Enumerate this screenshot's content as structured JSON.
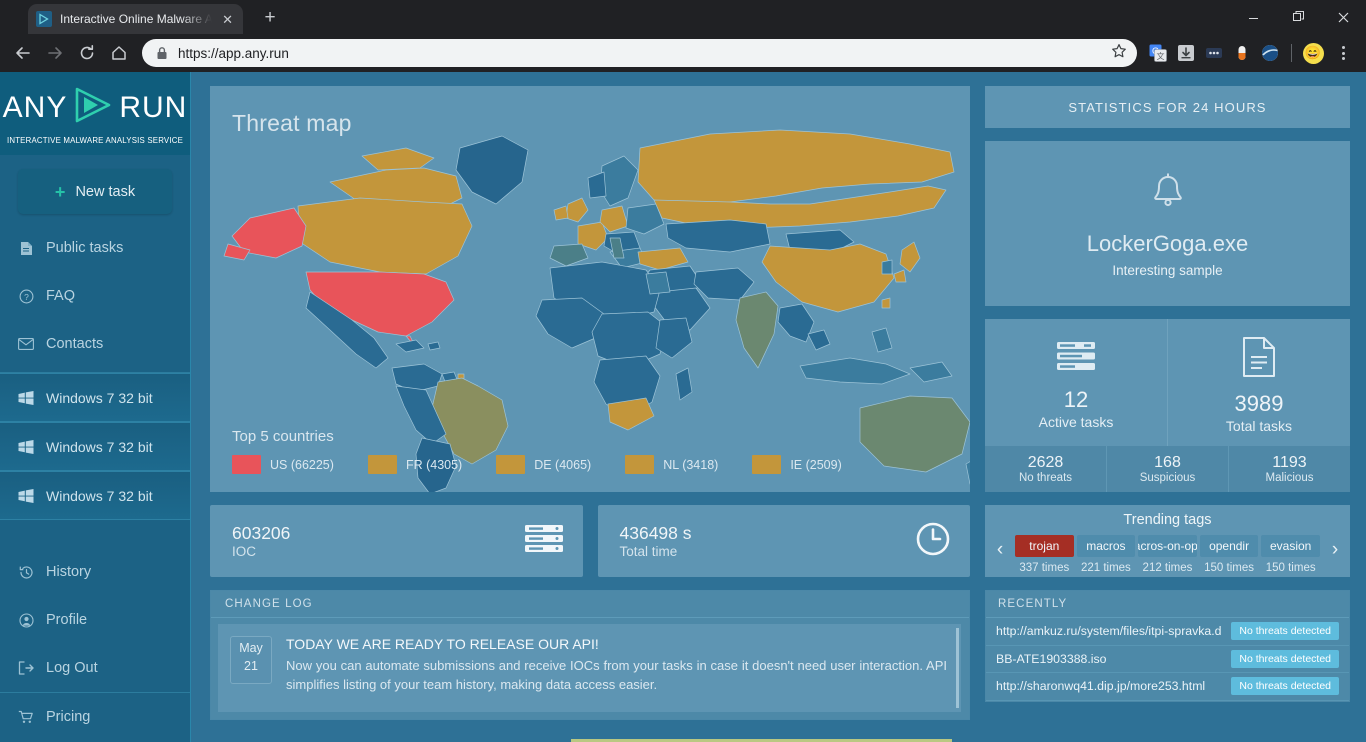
{
  "browser": {
    "tab_title": "Interactive Online Malware Ana",
    "tab_close": "✕",
    "new_tab": "+",
    "url": "https://app.any.run",
    "back_icon": "back-arrow",
    "forward_icon": "forward-arrow",
    "reload_icon": "reload",
    "home_icon": "home",
    "minimize": "–",
    "maximize": "❐",
    "close": "✕"
  },
  "sidebar": {
    "logo_any": "ANY",
    "logo_run": "RUN",
    "tagline": "INTERACTIVE MALWARE ANALYSIS SERVICE",
    "new_task": "New task",
    "nav": [
      {
        "label": "Public tasks",
        "icon": "document-icon"
      },
      {
        "label": "FAQ",
        "icon": "question-circle-icon"
      },
      {
        "label": "Contacts",
        "icon": "envelope-icon"
      }
    ],
    "vms": [
      {
        "label": "Windows 7 32 bit",
        "icon": "windows-icon"
      },
      {
        "label": "Windows 7 32 bit",
        "icon": "windows-icon"
      },
      {
        "label": "Windows 7 32 bit",
        "icon": "windows-icon"
      }
    ],
    "account": [
      {
        "label": "History",
        "icon": "history-icon"
      },
      {
        "label": "Profile",
        "icon": "user-circle-icon"
      },
      {
        "label": "Log Out",
        "icon": "logout-icon"
      }
    ],
    "footer": [
      {
        "label": "Pricing",
        "icon": "cart-icon"
      }
    ]
  },
  "threat_map": {
    "title": "Threat map",
    "legend_title": "Top 5 countries",
    "legend": [
      {
        "label": "US (66225)",
        "color": "#e8545a"
      },
      {
        "label": "FR (4305)",
        "color": "#c3963b"
      },
      {
        "label": "DE (4065)",
        "color": "#c3963b"
      },
      {
        "label": "NL (3418)",
        "color": "#c3963b"
      },
      {
        "label": "IE (2509)",
        "color": "#c3963b"
      }
    ]
  },
  "cards": [
    {
      "value": "603206",
      "label": "IOC",
      "icon": "server-icon"
    },
    {
      "value": "436498 s",
      "label": "Total time",
      "icon": "clock-icon"
    }
  ],
  "change_log": {
    "header": "CHANGE LOG",
    "month": "May",
    "day": "21",
    "headline": "TODAY WE ARE READY TO RELEASE OUR API!",
    "body": "Now you can automate submissions and receive IOCs from your tasks in case it doesn't need user interaction. API simplifies listing of your team history, making data access easier."
  },
  "statistics": {
    "header": "STATISTICS FOR 24 HOURS",
    "sample": {
      "name": "LockerGoga.exe",
      "subtitle": "Interesting sample",
      "icon": "bell-icon"
    },
    "top": [
      {
        "value": "12",
        "label": "Active tasks",
        "icon": "server-icon"
      },
      {
        "value": "3989",
        "label": "Total tasks",
        "icon": "document-icon"
      }
    ],
    "bottom": [
      {
        "value": "2628",
        "label": "No threats"
      },
      {
        "value": "168",
        "label": "Suspicious"
      },
      {
        "value": "1193",
        "label": "Malicious"
      }
    ]
  },
  "trending": {
    "title": "Trending tags",
    "prev_icon": "chevron-left-icon",
    "next_icon": "chevron-right-icon",
    "tags": [
      {
        "name": "trojan",
        "count": "337 times",
        "highlighted": true
      },
      {
        "name": "macros",
        "count": "221 times",
        "highlighted": false
      },
      {
        "name": "macros-on-open",
        "count": "212 times",
        "highlighted": false
      },
      {
        "name": "opendir",
        "count": "150 times",
        "highlighted": false
      },
      {
        "name": "evasion",
        "count": "150 times",
        "highlighted": false
      }
    ]
  },
  "recently": {
    "header": "RECENTLY",
    "rows": [
      {
        "name": "http://amkuz.ru/system/files/itpi-spravka.doc",
        "status": "No threats detected"
      },
      {
        "name": "BB-ATE1903388.iso",
        "status": "No threats detected"
      },
      {
        "name": "http://sharonwq41.dip.jp/more253.html",
        "status": "No threats detected"
      }
    ]
  }
}
